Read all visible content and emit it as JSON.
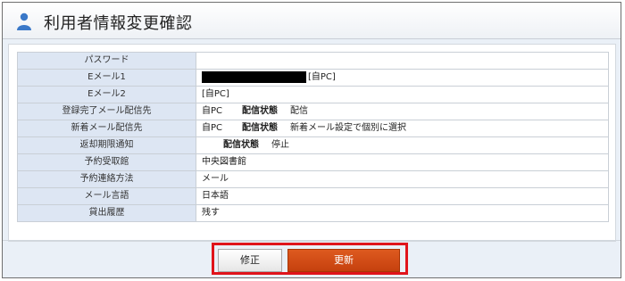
{
  "header": {
    "title": "利用者情報変更確認",
    "icon": "user-icon"
  },
  "rows": [
    {
      "label": "パスワード",
      "value": ""
    },
    {
      "label": "Eメール1",
      "masked": true,
      "value": "[自PC]"
    },
    {
      "label": "Eメール2",
      "value": "[自PC]"
    },
    {
      "label": "登録完了メール配信先",
      "value": "自PC",
      "sub_label": "配信状態",
      "sub_value": "配信"
    },
    {
      "label": "新着メール配信先",
      "value": "自PC",
      "sub_label": "配信状態",
      "sub_value": "新着メール設定で個別に選択"
    },
    {
      "label": "返却期限通知",
      "sub_label": "配信状態",
      "sub_value": "停止"
    },
    {
      "label": "予約受取館",
      "value": "中央図書館"
    },
    {
      "label": "予約連絡方法",
      "value": "メール"
    },
    {
      "label": "メール言語",
      "value": "日本語"
    },
    {
      "label": "貸出履歴",
      "value": "残す"
    }
  ],
  "buttons": {
    "modify": "修正",
    "update": "更新"
  },
  "colors": {
    "label_bg": "#dde6f3",
    "update_button": "#c94a12",
    "highlight_border": "#e0141b"
  }
}
